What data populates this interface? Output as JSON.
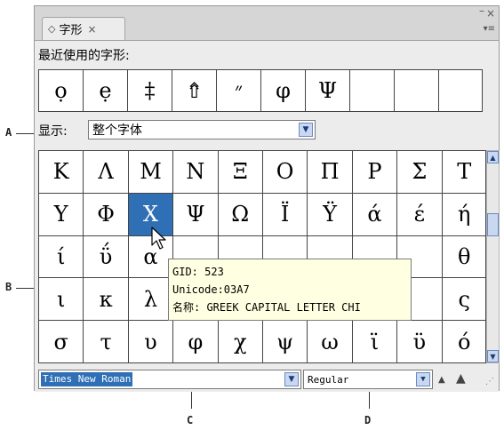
{
  "panel": {
    "tab_label": "字形",
    "tab_close": "×",
    "win_close": "×",
    "win_min": "–",
    "menu_glyph": "▾≡"
  },
  "recent": {
    "label": "最近使用的字形:",
    "glyphs": [
      "ọ",
      "ẹ",
      "‡",
      "⇮",
      "״",
      "φ",
      "Ψ",
      "",
      "",
      ""
    ]
  },
  "show": {
    "label": "显示:",
    "value": "整个字体"
  },
  "glyph_grid": [
    "Κ",
    "Λ",
    "Μ",
    "Ν",
    "Ξ",
    "Ο",
    "Π",
    "Ρ",
    "Σ",
    "Τ",
    "Υ",
    "Φ",
    "Χ",
    "Ψ",
    "Ω",
    "Ϊ",
    "Ϋ",
    "ά",
    "έ",
    "ή",
    "ί",
    "ΰ",
    "α",
    "",
    "",
    "",
    "",
    "",
    "",
    "θ",
    "ι",
    "κ",
    "λ",
    "",
    "",
    "",
    "",
    "",
    "",
    "ς",
    "σ",
    "τ",
    "υ",
    "φ",
    "χ",
    "ψ",
    "ω",
    "ϊ",
    "ϋ",
    "ό"
  ],
  "selected_glyph": "Χ",
  "tooltip": {
    "gid": "GID: 523",
    "unicode": "Unicode:03A7",
    "name": "名称: GREEK CAPITAL LETTER CHI"
  },
  "font_family": "Times New Roman",
  "font_style": "Regular",
  "callouts": {
    "a": "A",
    "b": "B",
    "c": "C",
    "d": "D"
  }
}
